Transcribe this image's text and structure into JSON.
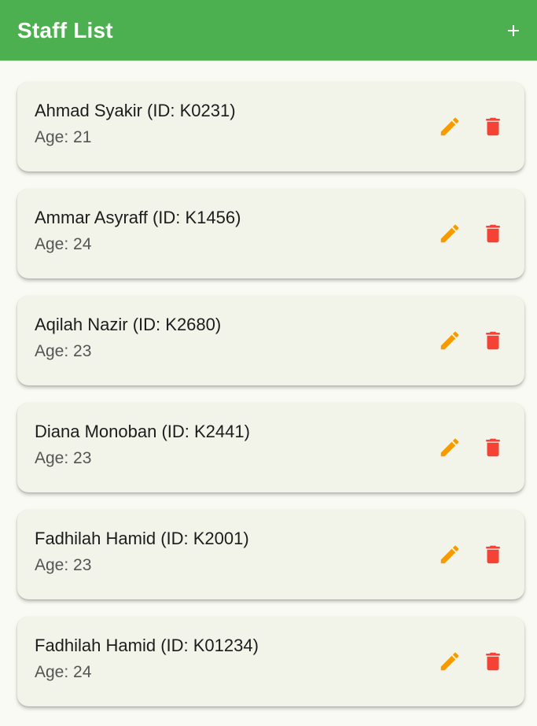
{
  "appbar": {
    "title": "Staff List",
    "add_icon": "plus-icon",
    "color": "#4caf50"
  },
  "colors": {
    "edit": "#f59b00",
    "delete": "#f44336",
    "card_bg": "#f2f4ea",
    "page_bg": "#f8faf3"
  },
  "staff": [
    {
      "name": "Ahmad Syakir (ID: K0231)",
      "age": "Age: 21"
    },
    {
      "name": "Ammar Asyraff (ID: K1456)",
      "age": "Age: 24"
    },
    {
      "name": "Aqilah Nazir (ID: K2680)",
      "age": "Age: 23"
    },
    {
      "name": "Diana Monoban (ID: K2441)",
      "age": "Age: 23"
    },
    {
      "name": "Fadhilah Hamid (ID: K2001)",
      "age": "Age: 23"
    },
    {
      "name": "Fadhilah Hamid (ID: K01234)",
      "age": "Age: 24"
    }
  ],
  "icons": {
    "edit": "pencil-icon",
    "delete": "trash-icon"
  }
}
